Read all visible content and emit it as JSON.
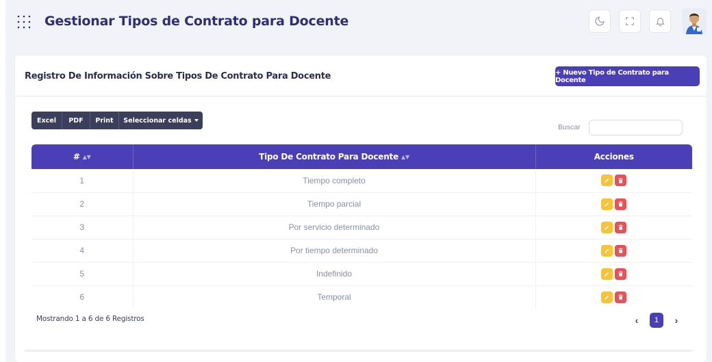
{
  "header": {
    "title": "Gestionar Tipos de Contrato para Docente",
    "icons": [
      "grid-dots-icon",
      "moon-icon",
      "expand-icon",
      "bell-icon",
      "avatar"
    ]
  },
  "card": {
    "title": "Registro De Información Sobre Tipos De Contrato Para Docente",
    "new_button": "+ Nuevo Tipo de Contrato para Docente"
  },
  "toolbar": {
    "excel": "Excel",
    "pdf": "PDF",
    "print": "Print",
    "select_cells": "Seleccionar celdas"
  },
  "search": {
    "label": "Buscar",
    "value": ""
  },
  "table": {
    "columns": [
      "#",
      "Tipo De Contrato Para Docente",
      "Acciones"
    ],
    "rows": [
      {
        "id": "1",
        "tipo": "Tiempo completo"
      },
      {
        "id": "2",
        "tipo": "Tiempo parcial"
      },
      {
        "id": "3",
        "tipo": "Por servicio determinado"
      },
      {
        "id": "4",
        "tipo": "Por tiempo determinado"
      },
      {
        "id": "5",
        "tipo": "Indefinido"
      },
      {
        "id": "6",
        "tipo": "Temporal"
      }
    ]
  },
  "footer": {
    "info": "Mostrando 1 a 6 de 6 Registros",
    "current_page": "1",
    "prev": "‹",
    "next": "›"
  },
  "colors": {
    "primary": "#4b3fb8",
    "dark": "#3b3f5c",
    "edit": "#f7c33b",
    "delete": "#e7515a"
  }
}
